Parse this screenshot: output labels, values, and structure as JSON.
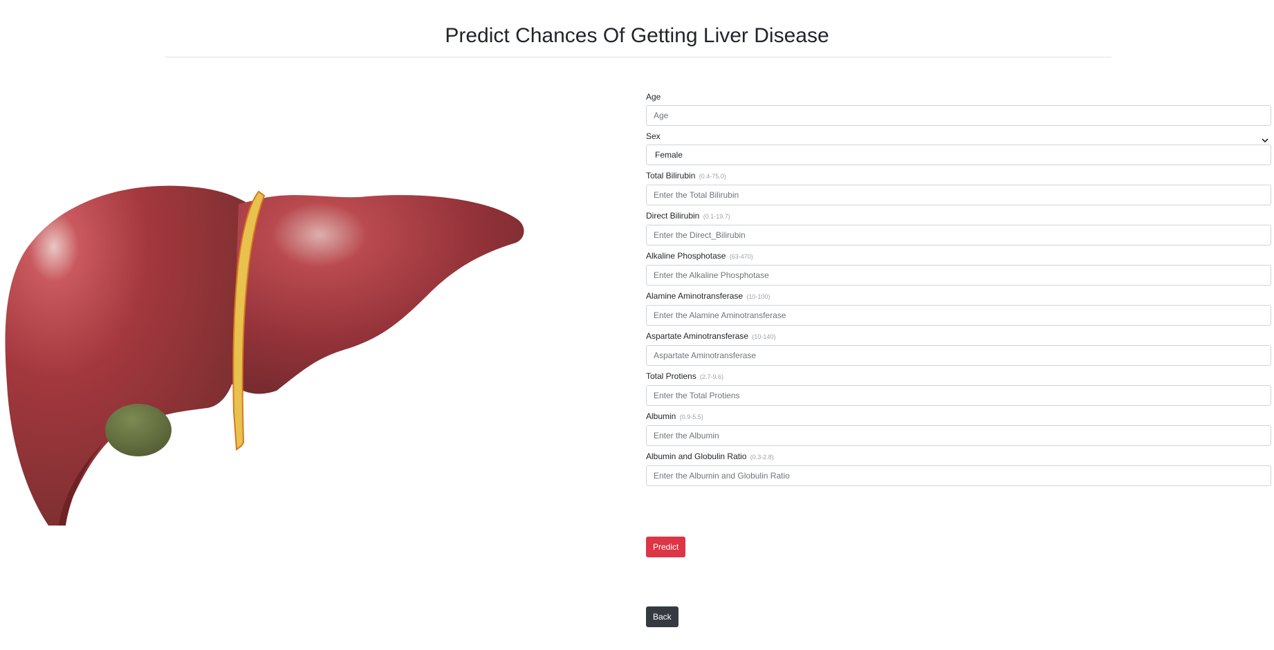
{
  "page": {
    "title": "Predict Chances Of Getting Liver Disease"
  },
  "form": {
    "fields": [
      {
        "label": "Age",
        "hint": "",
        "placeholder": "Age"
      },
      {
        "label": "Sex",
        "hint": "",
        "selected": "Female"
      },
      {
        "label": "Total Bilirubin",
        "hint": "(0.4-75.0)",
        "placeholder": "Enter the Total Bilirubin"
      },
      {
        "label": "Direct Bilirubin",
        "hint": "(0.1-19.7)",
        "placeholder": "Enter the Direct_Bilirubin"
      },
      {
        "label": "Alkaline Phosphotase",
        "hint": "(63-470)",
        "placeholder": "Enter the Alkaline Phosphotase"
      },
      {
        "label": "Alamine Aminotransferase",
        "hint": "(10-100)",
        "placeholder": "Enter the Alamine Aminotransferase"
      },
      {
        "label": "Aspartate Aminotransferase",
        "hint": "(10-140)",
        "placeholder": "Aspartate Aminotransferase"
      },
      {
        "label": "Total Protiens",
        "hint": "(2.7-9.6)",
        "placeholder": "Enter the Total Protiens"
      },
      {
        "label": "Albumin",
        "hint": "(0.9-5.5)",
        "placeholder": "Enter the Albumin"
      },
      {
        "label": "Albumin and Globulin Ratio",
        "hint": "(0.3-2.8)",
        "placeholder": "Enter the Albumin and Globulin Ratio"
      }
    ],
    "predict_label": "Predict",
    "back_label": "Back"
  },
  "colors": {
    "predict": "#dc3545",
    "back": "#343a40"
  },
  "icons": {
    "select": "chevron-down-icon"
  }
}
